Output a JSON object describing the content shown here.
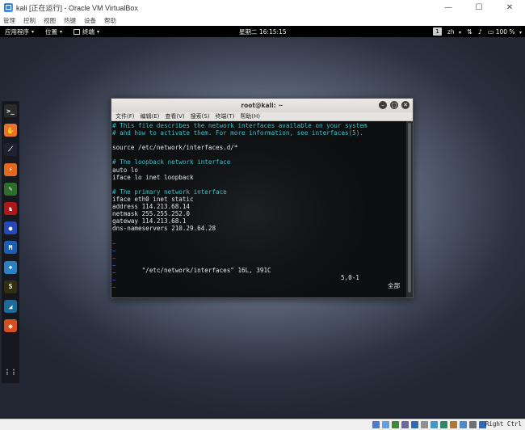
{
  "host": {
    "title": "kali [正在运行] - Oracle VM VirtualBox",
    "window_buttons": [
      "—",
      "☐",
      "✕"
    ],
    "menus": [
      "管理",
      "控制",
      "视图",
      "热键",
      "设备",
      "帮助"
    ],
    "status_right": "Right Ctrl"
  },
  "gnome": {
    "apps": "应用程序",
    "places": "位置",
    "terminal": "终端",
    "clock": "星期二 16:15:15",
    "workspace": "1",
    "input_method": "zh",
    "battery": "100 %"
  },
  "dock": {
    "items": [
      {
        "icon": "terminal-icon",
        "glyph": ">_",
        "bg": "#2b2b2b"
      },
      {
        "icon": "burpsuite-icon",
        "glyph": "✋",
        "bg": "#e8722a"
      },
      {
        "icon": "armitage-icon",
        "glyph": "⟋",
        "bg": "#1e2230"
      },
      {
        "icon": "burp-icon",
        "glyph": "⚡",
        "bg": "#e06a20"
      },
      {
        "icon": "leafpad-icon",
        "glyph": "✎",
        "bg": "#2d6e2a"
      },
      {
        "icon": "faraday-icon",
        "glyph": "♞",
        "bg": "#b01818"
      },
      {
        "icon": "maltego-icon",
        "glyph": "●",
        "bg": "#2848b8"
      },
      {
        "icon": "metasploit-icon",
        "glyph": "M",
        "bg": "#1c5fb0"
      },
      {
        "icon": "owasp-zap-icon",
        "glyph": "◈",
        "bg": "#2a80c0"
      },
      {
        "icon": "sqlmap-icon",
        "glyph": "S",
        "bg": "#303010"
      },
      {
        "icon": "wireshark-icon",
        "glyph": "◢",
        "bg": "#1a6a9a"
      },
      {
        "icon": "cherrytree-icon",
        "glyph": "◉",
        "bg": "#d44f20"
      },
      {
        "icon": "show-apps-icon",
        "glyph": "⋮⋮",
        "bg": "transparent"
      }
    ]
  },
  "terminal": {
    "title": "root@kali: ~",
    "menus": [
      "文件(F)",
      "编辑(E)",
      "查看(V)",
      "搜索(S)",
      "终端(T)",
      "帮助(H)"
    ],
    "lines": [
      {
        "text": "# This file describes the network interfaces available on your system",
        "kind": "comment"
      },
      {
        "text": "# and how to activate them. For more information, see interfaces(5).",
        "kind": "comment"
      },
      {
        "text": "",
        "kind": "text"
      },
      {
        "text": "source /etc/network/interfaces.d/*",
        "kind": "text"
      },
      {
        "text": "",
        "kind": "text"
      },
      {
        "text": "# The loopback network interface",
        "kind": "comment"
      },
      {
        "text": "auto lo",
        "kind": "text"
      },
      {
        "text": "iface lo inet loopback",
        "kind": "text"
      },
      {
        "text": "",
        "kind": "text"
      },
      {
        "text": "# The primary network interface",
        "kind": "comment"
      },
      {
        "text": "iface eth0 inet static",
        "kind": "text"
      },
      {
        "text": "address 114.213.68.14",
        "kind": "text"
      },
      {
        "text": "netmask 255.255.252.0",
        "kind": "text"
      },
      {
        "text": "gateway 114.213.68.1",
        "kind": "text"
      },
      {
        "text": "dns-nameservers 210.29.64.28",
        "kind": "text"
      },
      {
        "text": "",
        "kind": "text"
      },
      {
        "text": "~",
        "kind": "tilde"
      },
      {
        "text": "~",
        "kind": "tilde"
      },
      {
        "text": "~",
        "kind": "tilde"
      },
      {
        "text": "~",
        "kind": "tilde"
      },
      {
        "text": "~",
        "kind": "tilde"
      },
      {
        "text": "~",
        "kind": "tilde"
      },
      {
        "text": "~",
        "kind": "tilde"
      }
    ],
    "status_file": "\"/etc/network/interfaces\" 16L, 391C",
    "status_pos": "5,0-1",
    "status_all": "全部"
  },
  "host_status_colors": [
    "#4a7bd0",
    "#5fa0e0",
    "#3a8a3a",
    "#6a6a9a",
    "#2a6bbd",
    "#909090",
    "#3a9ad0",
    "#2a8a6a",
    "#b07a2a",
    "#4a8ad0",
    "#707070",
    "#2a6bbd"
  ]
}
